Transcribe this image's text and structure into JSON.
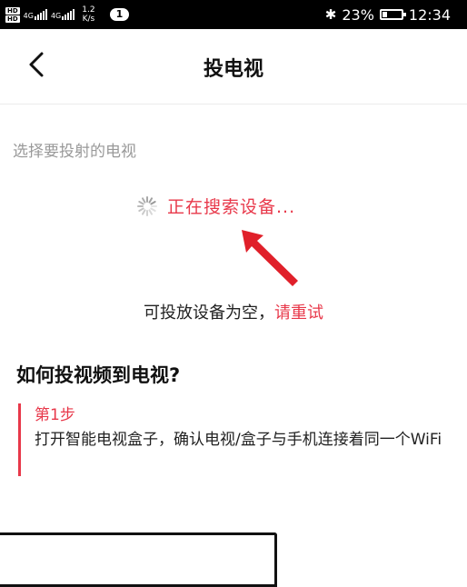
{
  "status_bar": {
    "hd1": "HD",
    "hd2": "HD",
    "net1": "4G",
    "net2": "4G",
    "speed_value": "1.2",
    "speed_unit": "K/s",
    "notification_count": "1",
    "bluetooth_icon": "bluetooth-icon",
    "battery_percent": "23%",
    "battery_level": 0.23,
    "time": "12:34"
  },
  "nav": {
    "back_icon": "chevron-left-icon",
    "title": "投电视"
  },
  "device_section": {
    "label": "选择要投射的电视",
    "searching_text": "正在搜索设备...",
    "empty_text": "可投放设备为空，",
    "retry_text": "请重试"
  },
  "howto": {
    "title": "如何投视频到电视?",
    "step_label": "第1步",
    "step_desc": "打开智能电视盒子，确认电视/盒子与手机连接着同一个WiFi"
  },
  "colors": {
    "accent": "#e8384a",
    "annotation_arrow": "#e0202a"
  }
}
